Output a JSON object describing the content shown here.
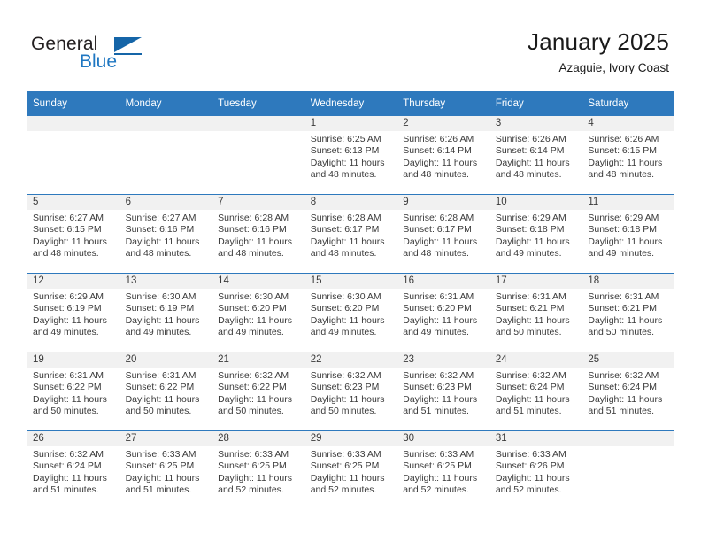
{
  "brand": {
    "name_part1": "General",
    "name_part2": "Blue",
    "logo_icon": "blue-triangle-flag-icon",
    "accent_color": "#1565a8"
  },
  "header": {
    "title": "January 2025",
    "location": "Azaguie, Ivory Coast"
  },
  "theme": {
    "header_blue": "#2e79bd",
    "daynum_band": "#f1f1f1",
    "text": "#3a3a3a"
  },
  "weekday_headers": [
    "Sunday",
    "Monday",
    "Tuesday",
    "Wednesday",
    "Thursday",
    "Friday",
    "Saturday"
  ],
  "weeks": [
    [
      {
        "day": "",
        "sunrise": "",
        "sunset": "",
        "daylight_1": "",
        "daylight_2": ""
      },
      {
        "day": "",
        "sunrise": "",
        "sunset": "",
        "daylight_1": "",
        "daylight_2": ""
      },
      {
        "day": "",
        "sunrise": "",
        "sunset": "",
        "daylight_1": "",
        "daylight_2": ""
      },
      {
        "day": "1",
        "sunrise": "Sunrise: 6:25 AM",
        "sunset": "Sunset: 6:13 PM",
        "daylight_1": "Daylight: 11 hours",
        "daylight_2": "and 48 minutes."
      },
      {
        "day": "2",
        "sunrise": "Sunrise: 6:26 AM",
        "sunset": "Sunset: 6:14 PM",
        "daylight_1": "Daylight: 11 hours",
        "daylight_2": "and 48 minutes."
      },
      {
        "day": "3",
        "sunrise": "Sunrise: 6:26 AM",
        "sunset": "Sunset: 6:14 PM",
        "daylight_1": "Daylight: 11 hours",
        "daylight_2": "and 48 minutes."
      },
      {
        "day": "4",
        "sunrise": "Sunrise: 6:26 AM",
        "sunset": "Sunset: 6:15 PM",
        "daylight_1": "Daylight: 11 hours",
        "daylight_2": "and 48 minutes."
      }
    ],
    [
      {
        "day": "5",
        "sunrise": "Sunrise: 6:27 AM",
        "sunset": "Sunset: 6:15 PM",
        "daylight_1": "Daylight: 11 hours",
        "daylight_2": "and 48 minutes."
      },
      {
        "day": "6",
        "sunrise": "Sunrise: 6:27 AM",
        "sunset": "Sunset: 6:16 PM",
        "daylight_1": "Daylight: 11 hours",
        "daylight_2": "and 48 minutes."
      },
      {
        "day": "7",
        "sunrise": "Sunrise: 6:28 AM",
        "sunset": "Sunset: 6:16 PM",
        "daylight_1": "Daylight: 11 hours",
        "daylight_2": "and 48 minutes."
      },
      {
        "day": "8",
        "sunrise": "Sunrise: 6:28 AM",
        "sunset": "Sunset: 6:17 PM",
        "daylight_1": "Daylight: 11 hours",
        "daylight_2": "and 48 minutes."
      },
      {
        "day": "9",
        "sunrise": "Sunrise: 6:28 AM",
        "sunset": "Sunset: 6:17 PM",
        "daylight_1": "Daylight: 11 hours",
        "daylight_2": "and 48 minutes."
      },
      {
        "day": "10",
        "sunrise": "Sunrise: 6:29 AM",
        "sunset": "Sunset: 6:18 PM",
        "daylight_1": "Daylight: 11 hours",
        "daylight_2": "and 49 minutes."
      },
      {
        "day": "11",
        "sunrise": "Sunrise: 6:29 AM",
        "sunset": "Sunset: 6:18 PM",
        "daylight_1": "Daylight: 11 hours",
        "daylight_2": "and 49 minutes."
      }
    ],
    [
      {
        "day": "12",
        "sunrise": "Sunrise: 6:29 AM",
        "sunset": "Sunset: 6:19 PM",
        "daylight_1": "Daylight: 11 hours",
        "daylight_2": "and 49 minutes."
      },
      {
        "day": "13",
        "sunrise": "Sunrise: 6:30 AM",
        "sunset": "Sunset: 6:19 PM",
        "daylight_1": "Daylight: 11 hours",
        "daylight_2": "and 49 minutes."
      },
      {
        "day": "14",
        "sunrise": "Sunrise: 6:30 AM",
        "sunset": "Sunset: 6:20 PM",
        "daylight_1": "Daylight: 11 hours",
        "daylight_2": "and 49 minutes."
      },
      {
        "day": "15",
        "sunrise": "Sunrise: 6:30 AM",
        "sunset": "Sunset: 6:20 PM",
        "daylight_1": "Daylight: 11 hours",
        "daylight_2": "and 49 minutes."
      },
      {
        "day": "16",
        "sunrise": "Sunrise: 6:31 AM",
        "sunset": "Sunset: 6:20 PM",
        "daylight_1": "Daylight: 11 hours",
        "daylight_2": "and 49 minutes."
      },
      {
        "day": "17",
        "sunrise": "Sunrise: 6:31 AM",
        "sunset": "Sunset: 6:21 PM",
        "daylight_1": "Daylight: 11 hours",
        "daylight_2": "and 50 minutes."
      },
      {
        "day": "18",
        "sunrise": "Sunrise: 6:31 AM",
        "sunset": "Sunset: 6:21 PM",
        "daylight_1": "Daylight: 11 hours",
        "daylight_2": "and 50 minutes."
      }
    ],
    [
      {
        "day": "19",
        "sunrise": "Sunrise: 6:31 AM",
        "sunset": "Sunset: 6:22 PM",
        "daylight_1": "Daylight: 11 hours",
        "daylight_2": "and 50 minutes."
      },
      {
        "day": "20",
        "sunrise": "Sunrise: 6:31 AM",
        "sunset": "Sunset: 6:22 PM",
        "daylight_1": "Daylight: 11 hours",
        "daylight_2": "and 50 minutes."
      },
      {
        "day": "21",
        "sunrise": "Sunrise: 6:32 AM",
        "sunset": "Sunset: 6:22 PM",
        "daylight_1": "Daylight: 11 hours",
        "daylight_2": "and 50 minutes."
      },
      {
        "day": "22",
        "sunrise": "Sunrise: 6:32 AM",
        "sunset": "Sunset: 6:23 PM",
        "daylight_1": "Daylight: 11 hours",
        "daylight_2": "and 50 minutes."
      },
      {
        "day": "23",
        "sunrise": "Sunrise: 6:32 AM",
        "sunset": "Sunset: 6:23 PM",
        "daylight_1": "Daylight: 11 hours",
        "daylight_2": "and 51 minutes."
      },
      {
        "day": "24",
        "sunrise": "Sunrise: 6:32 AM",
        "sunset": "Sunset: 6:24 PM",
        "daylight_1": "Daylight: 11 hours",
        "daylight_2": "and 51 minutes."
      },
      {
        "day": "25",
        "sunrise": "Sunrise: 6:32 AM",
        "sunset": "Sunset: 6:24 PM",
        "daylight_1": "Daylight: 11 hours",
        "daylight_2": "and 51 minutes."
      }
    ],
    [
      {
        "day": "26",
        "sunrise": "Sunrise: 6:32 AM",
        "sunset": "Sunset: 6:24 PM",
        "daylight_1": "Daylight: 11 hours",
        "daylight_2": "and 51 minutes."
      },
      {
        "day": "27",
        "sunrise": "Sunrise: 6:33 AM",
        "sunset": "Sunset: 6:25 PM",
        "daylight_1": "Daylight: 11 hours",
        "daylight_2": "and 51 minutes."
      },
      {
        "day": "28",
        "sunrise": "Sunrise: 6:33 AM",
        "sunset": "Sunset: 6:25 PM",
        "daylight_1": "Daylight: 11 hours",
        "daylight_2": "and 52 minutes."
      },
      {
        "day": "29",
        "sunrise": "Sunrise: 6:33 AM",
        "sunset": "Sunset: 6:25 PM",
        "daylight_1": "Daylight: 11 hours",
        "daylight_2": "and 52 minutes."
      },
      {
        "day": "30",
        "sunrise": "Sunrise: 6:33 AM",
        "sunset": "Sunset: 6:25 PM",
        "daylight_1": "Daylight: 11 hours",
        "daylight_2": "and 52 minutes."
      },
      {
        "day": "31",
        "sunrise": "Sunrise: 6:33 AM",
        "sunset": "Sunset: 6:26 PM",
        "daylight_1": "Daylight: 11 hours",
        "daylight_2": "and 52 minutes."
      },
      {
        "day": "",
        "sunrise": "",
        "sunset": "",
        "daylight_1": "",
        "daylight_2": ""
      }
    ]
  ]
}
